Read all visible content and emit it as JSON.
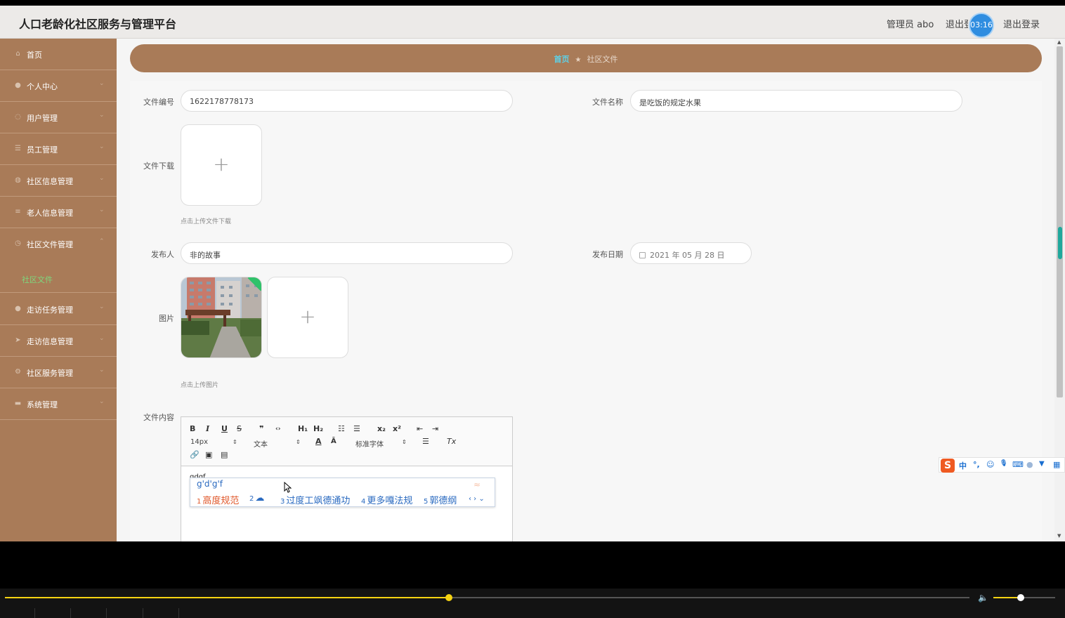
{
  "header": {
    "app_title": "人口老龄化社区服务与管理平台",
    "admin_label": "管理员 abo",
    "logout_truncated": "退出登录",
    "timer": "03:16",
    "logout": "退出登录"
  },
  "sidebar": {
    "items": [
      {
        "label": "首页",
        "icon": "home-icon",
        "expanded": false
      },
      {
        "label": "个人中心",
        "icon": "person-icon"
      },
      {
        "label": "用户管理",
        "icon": "users-icon"
      },
      {
        "label": "员工管理",
        "icon": "list-icon"
      },
      {
        "label": "社区信息管理",
        "icon": "info-icon"
      },
      {
        "label": "老人信息管理",
        "icon": "menu-icon"
      },
      {
        "label": "社区文件管理",
        "icon": "clock-icon",
        "expanded": true
      },
      {
        "label": "走访任务管理",
        "icon": "person-icon"
      },
      {
        "label": "走访信息管理",
        "icon": "send-icon"
      },
      {
        "label": "社区服务管理",
        "icon": "gear-icon"
      },
      {
        "label": "系统管理",
        "icon": "chat-icon"
      }
    ],
    "sub_item": "社区文件"
  },
  "breadcrumb": {
    "home": "首页",
    "current": "社区文件"
  },
  "form": {
    "file_no_label": "文件编号",
    "file_no_value": "1622178778173",
    "file_name_label": "文件名称",
    "file_name_value": "是吃饭的规定水果",
    "download_label": "文件下载",
    "download_hint": "点击上传文件下载",
    "publisher_label": "发布人",
    "publisher_value": "非的故事",
    "date_label": "发布日期",
    "date_value": "2021 年 05 月 28 日",
    "image_label": "图片",
    "image_hint": "点击上传图片",
    "content_label": "文件内容"
  },
  "editor": {
    "toolbar_row1": [
      "B",
      "I",
      "U",
      "S",
      "❞",
      "‹›",
      "H₁",
      "H₂",
      "☷",
      "☰",
      "x₂",
      "x²",
      "⇤",
      "⇥"
    ],
    "font_size": "14px",
    "text_style": "文本",
    "font_family": "标准字体",
    "text_value": "gdgf"
  },
  "ime": {
    "input": "g'd'g'f",
    "candidates": [
      {
        "n": "1",
        "text": "高度规范"
      },
      {
        "n": "2",
        "text": "☁"
      },
      {
        "n": "3",
        "text": "过度工飒德通功"
      },
      {
        "n": "4",
        "text": "更多嘎法规"
      },
      {
        "n": "5",
        "text": "郭德纲"
      }
    ],
    "toolbar_items": [
      "中",
      "°,",
      "☺",
      "🎤",
      "⌨",
      "👤",
      "👕",
      "▦"
    ]
  },
  "player": {
    "progress": 0.46,
    "volume": 0.44
  }
}
